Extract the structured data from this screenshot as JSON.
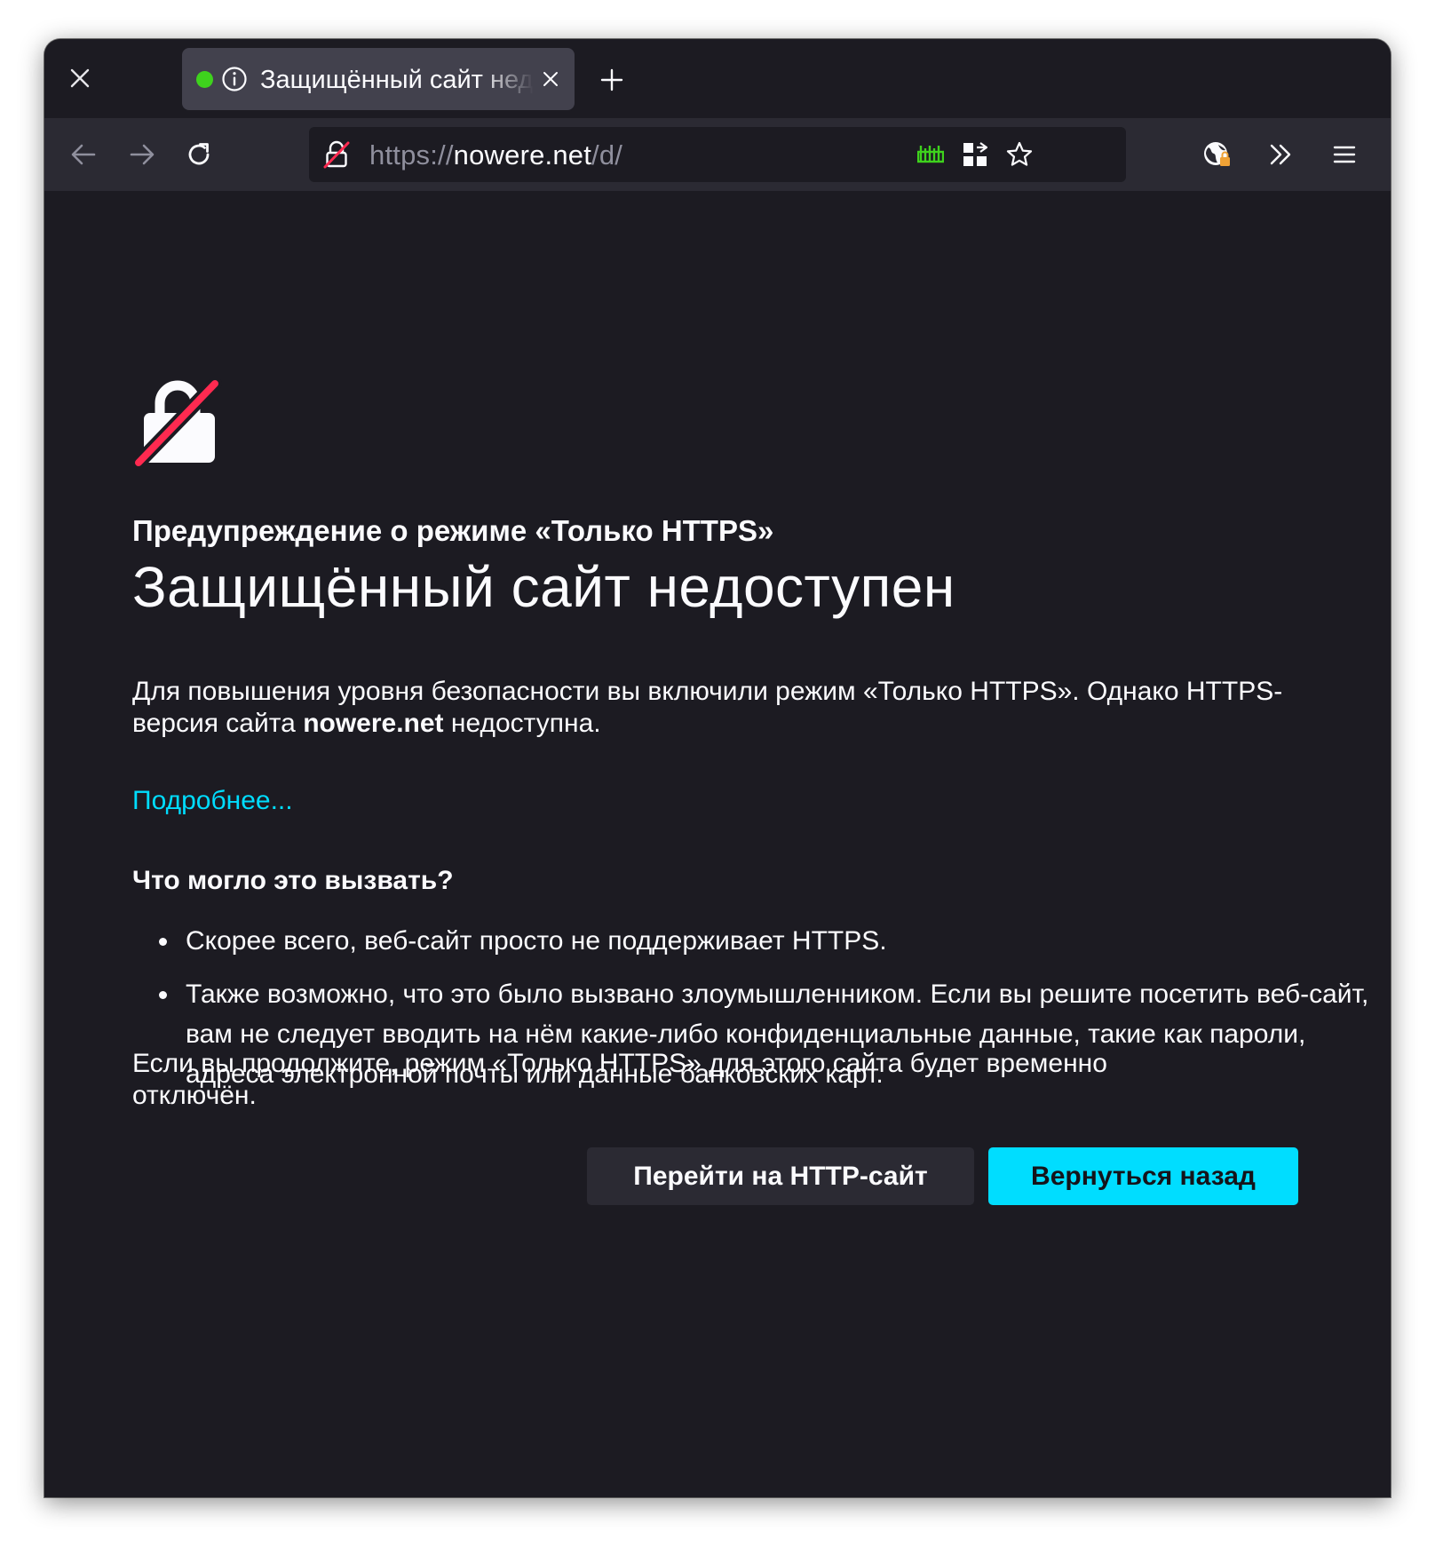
{
  "colors": {
    "window_bg": "#1c1b22",
    "toolbar_bg": "#2b2a33",
    "tab_bg": "#42414d",
    "accent": "#00ddff",
    "text": "#fbfbfe",
    "muted": "#8f8f9d",
    "danger": "#ff2a50",
    "tab_status": "#3ed21d"
  },
  "tab": {
    "title": "Защищённый сайт недоступен",
    "status_icon": "green-dot-icon",
    "info_icon": "info-icon",
    "close_icon": "close-icon"
  },
  "toolbar": {
    "window_close_icon": "close-icon",
    "new_tab_icon": "plus-icon",
    "back_icon": "arrow-left-icon",
    "forward_icon": "arrow-right-icon",
    "reload_icon": "reload-icon",
    "overflow_icon": "chevrons-right-icon",
    "menu_icon": "hamburger-icon",
    "extension_icon": "globe-lock-icon"
  },
  "urlbar": {
    "scheme": "https://",
    "host": "nowere.net",
    "path": "/d/",
    "lock_icon": "lock-broken-icon",
    "icons": [
      "ruler-icon",
      "qr-code-icon",
      "star-icon"
    ]
  },
  "page": {
    "lock_icon": "lock-disabled-icon",
    "eyebrow": "Предупреждение о режиме «Только HTTPS»",
    "headline": "Защищённый сайт недоступен",
    "intro_part1": "Для повышения уровня безопасности вы включили режим «Только HTTPS». Однако HTTPS-версия сайта ",
    "intro_host": "nowere.net",
    "intro_part2": " недоступна.",
    "learn_more": "Подробнее...",
    "causes_title": "Что могло это вызвать?",
    "causes": [
      "Скорее всего, веб-сайт просто не поддерживает HTTPS.",
      "Также возможно, что это было вызвано злоумышленником. Если вы решите посетить веб-сайт, вам не следует вводить на нём какие-либо конфиденциальные данные, такие как пароли, адреса электронной почты или данные банковских карт."
    ],
    "continue_note": "Если вы продолжите, режим «Только HTTPS» для этого сайта будет временно отключён.",
    "btn_continue": "Перейти на HTTP-сайт",
    "btn_back": "Вернуться назад"
  }
}
